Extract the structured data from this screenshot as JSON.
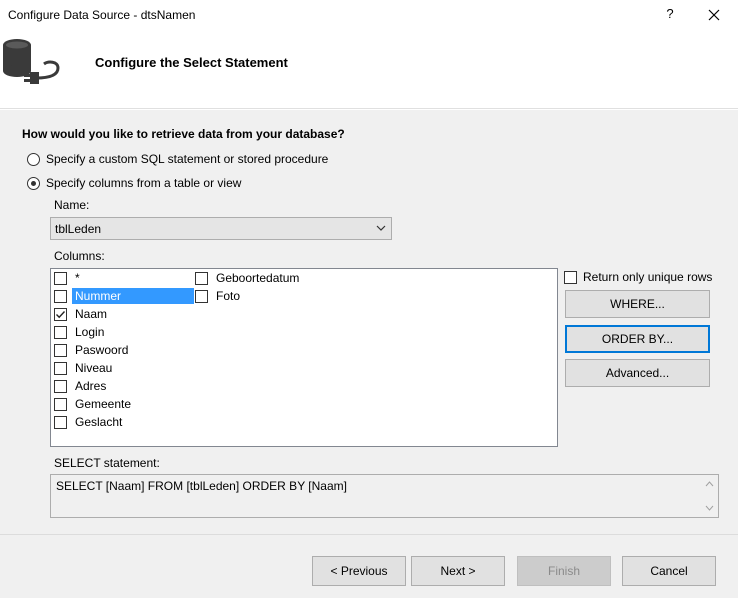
{
  "window": {
    "title": "Configure Data Source - dtsNamen",
    "help_glyph": "?"
  },
  "header": {
    "heading": "Configure the Select Statement",
    "icon": "database-connect-icon"
  },
  "question": "How would you like to retrieve data from your database?",
  "options": {
    "custom_sql": {
      "label": "Specify a custom SQL statement or stored procedure",
      "checked": false
    },
    "columns_from_table": {
      "label": "Specify columns from a table or view",
      "checked": true
    }
  },
  "name_field": {
    "label": "Name:",
    "value": "tblLeden"
  },
  "columns": {
    "label": "Columns:",
    "items": [
      {
        "name": "*",
        "checked": false,
        "selected": false
      },
      {
        "name": "Nummer",
        "checked": false,
        "selected": true
      },
      {
        "name": "Naam",
        "checked": true,
        "selected": false
      },
      {
        "name": "Login",
        "checked": false,
        "selected": false
      },
      {
        "name": "Paswoord",
        "checked": false,
        "selected": false
      },
      {
        "name": "Niveau",
        "checked": false,
        "selected": false
      },
      {
        "name": "Adres",
        "checked": false,
        "selected": false
      },
      {
        "name": "Gemeente",
        "checked": false,
        "selected": false
      },
      {
        "name": "Geslacht",
        "checked": false,
        "selected": false
      },
      {
        "name": "Geboortedatum",
        "checked": false,
        "selected": false
      },
      {
        "name": "Foto",
        "checked": false,
        "selected": false
      }
    ]
  },
  "unique_rows": {
    "label": "Return only unique rows",
    "checked": false
  },
  "buttons": {
    "where": "WHERE...",
    "order_by": "ORDER BY...",
    "advanced": "Advanced..."
  },
  "select_statement": {
    "label": "SELECT statement:",
    "value": "SELECT [Naam] FROM [tblLeden] ORDER BY [Naam]"
  },
  "footer": {
    "previous": "< Previous",
    "next": "Next >",
    "finish": "Finish",
    "cancel": "Cancel"
  },
  "colors": {
    "accent": "#0078d7",
    "selection": "#3399ff",
    "dialog_bg": "#f0f0f0"
  }
}
